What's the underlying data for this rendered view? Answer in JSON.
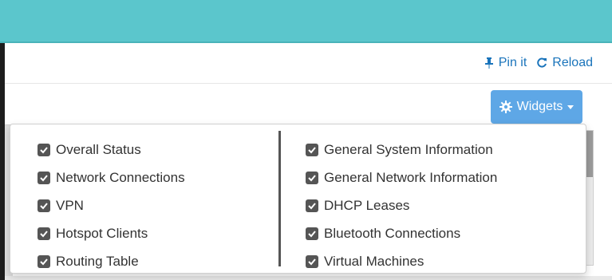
{
  "header": {
    "pin_label": "Pin it",
    "reload_label": "Reload"
  },
  "widgets_button": {
    "label": "Widgets"
  },
  "widget_options": {
    "left": [
      {
        "label": "Overall Status",
        "checked": true
      },
      {
        "label": "Network Connections",
        "checked": true
      },
      {
        "label": "VPN",
        "checked": true
      },
      {
        "label": "Hotspot Clients",
        "checked": true
      },
      {
        "label": "Routing Table",
        "checked": true
      }
    ],
    "right": [
      {
        "label": "General System Information",
        "checked": true
      },
      {
        "label": "General Network Information",
        "checked": true
      },
      {
        "label": "DHCP Leases",
        "checked": true
      },
      {
        "label": "Bluetooth Connections",
        "checked": true
      },
      {
        "label": "Virtual Machines",
        "checked": true
      }
    ]
  },
  "colors": {
    "topbar": "#5bc6cc",
    "link": "#1a74bb",
    "button": "#5ea7e6"
  }
}
